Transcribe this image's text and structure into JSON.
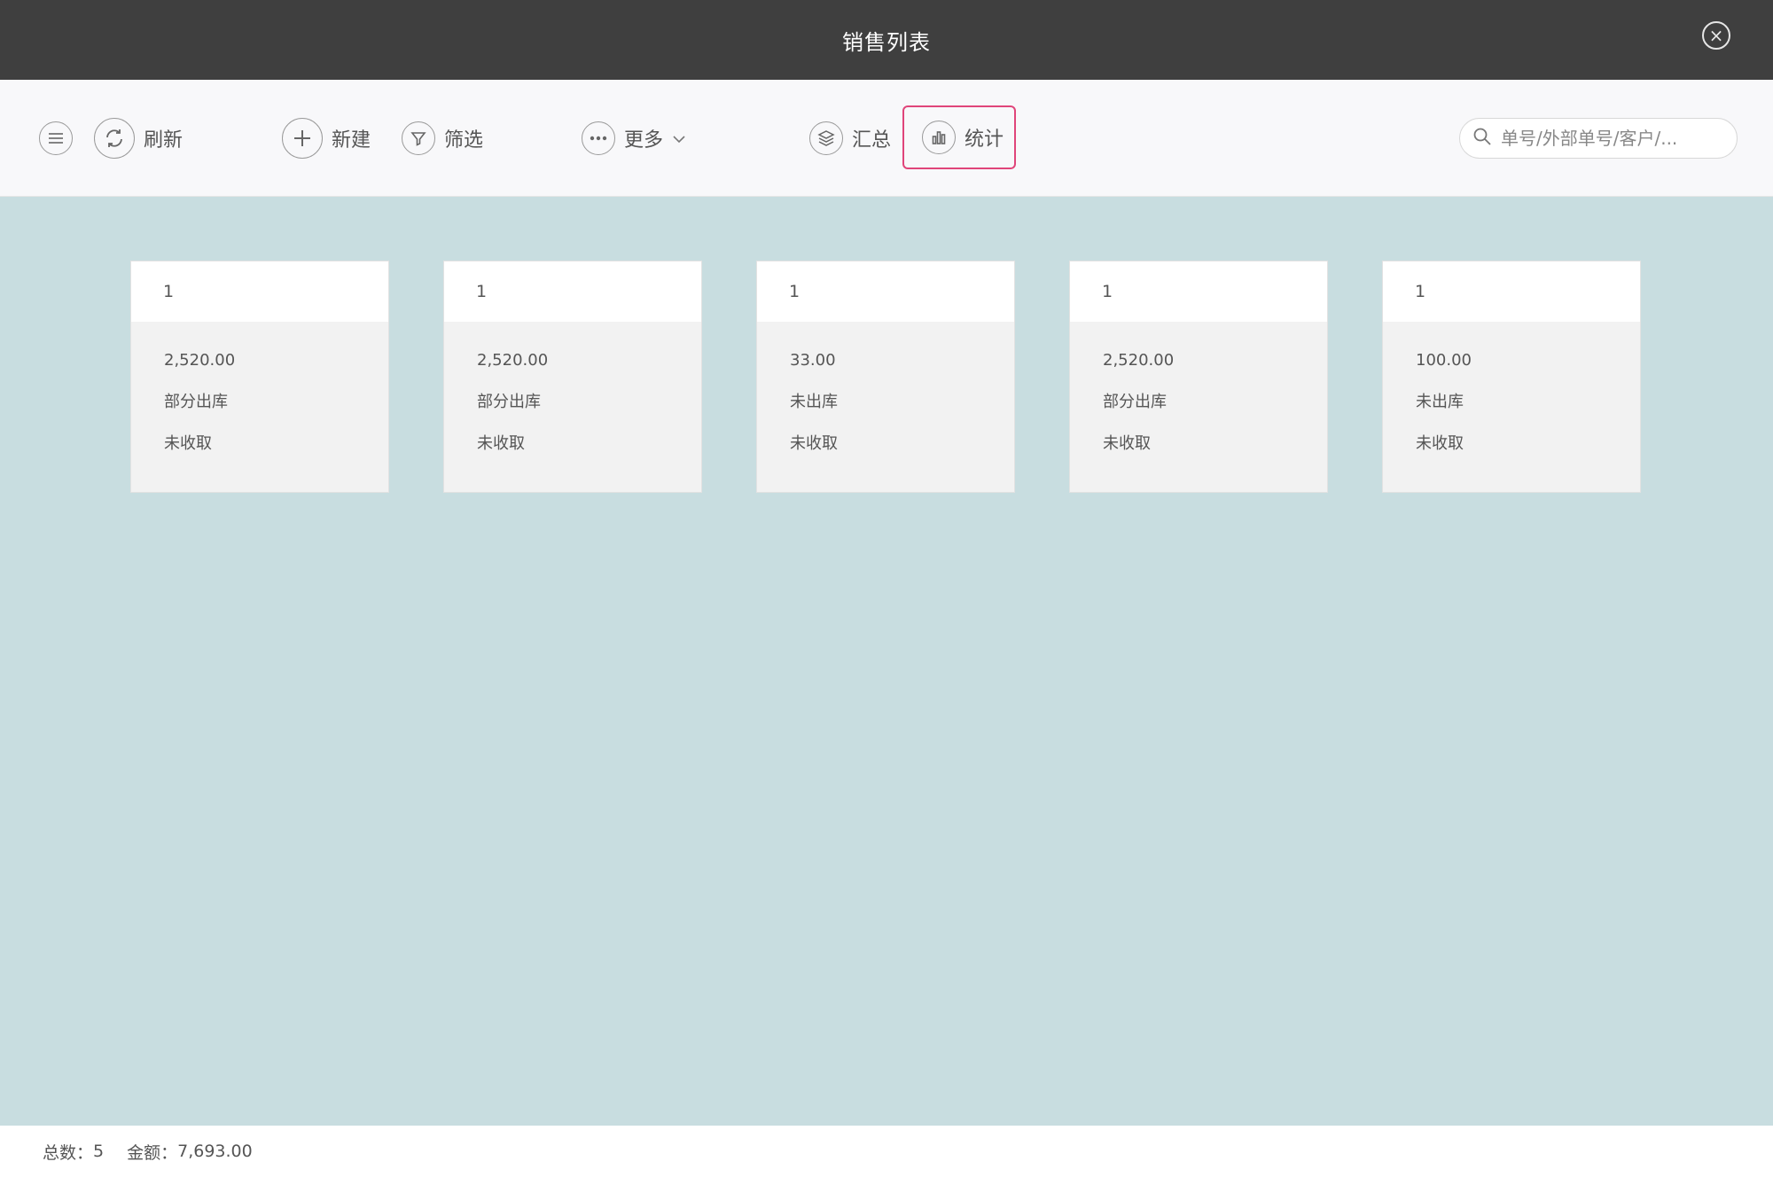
{
  "window": {
    "title": "销售列表"
  },
  "toolbar": {
    "refresh_label": "刷新",
    "new_label": "新建",
    "filter_label": "筛选",
    "more_label": "更多",
    "summary_label": "汇总",
    "stats_label": "统计",
    "highlight_color": "#e0457a"
  },
  "search": {
    "placeholder": "单号/外部单号/客户/..."
  },
  "cards": [
    {
      "title": "1",
      "amount": "2,520.00",
      "shipping_status": "部分出库",
      "payment_status": "未收取"
    },
    {
      "title": "1",
      "amount": "2,520.00",
      "shipping_status": "部分出库",
      "payment_status": "未收取"
    },
    {
      "title": "1",
      "amount": "33.00",
      "shipping_status": "未出库",
      "payment_status": "未收取"
    },
    {
      "title": "1",
      "amount": "2,520.00",
      "shipping_status": "部分出库",
      "payment_status": "未收取"
    },
    {
      "title": "1",
      "amount": "100.00",
      "shipping_status": "未出库",
      "payment_status": "未收取"
    }
  ],
  "footer": {
    "total_label": "总数：",
    "total_value": "5",
    "amount_label": "金额：",
    "amount_value": "7,693.00"
  }
}
